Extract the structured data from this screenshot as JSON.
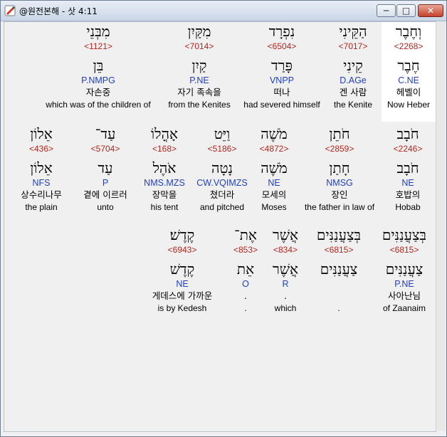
{
  "window": {
    "title": "@원전본해 - 삿 4:11",
    "minimize_label": "─",
    "maximize_label": "□",
    "close_label": "✕"
  },
  "colors": {
    "strong": "#b3261e",
    "morph": "#1f3fc0"
  },
  "rows": [
    {
      "words": [
        {
          "hebrew": "וְחֶבֶר",
          "strong": "<2268>",
          "lemma": "חֶבֶר",
          "morph": "C.NE",
          "korean": "헤벨이",
          "english": "Now Heber",
          "highlighted": true
        },
        {
          "hebrew": "הַקֵּינִי",
          "strong": "<7017>",
          "lemma": "קֵינִי",
          "morph": "D.AGe",
          "korean": "겐 사람",
          "english": "the Kenite",
          "highlighted": false
        },
        {
          "hebrew": "נִפְרָד",
          "strong": "<6504>",
          "lemma": "פָּרַד",
          "morph": "VNPP",
          "korean": "떠나",
          "english": "had severed himself",
          "highlighted": false
        },
        {
          "hebrew": "מִקַּיִן",
          "strong": "<7014>",
          "lemma": "קַיִן",
          "morph": "P.NE",
          "korean": "자기 족속을",
          "english": "from the Kenites",
          "highlighted": false
        },
        {
          "hebrew": "מִבְּנֵי",
          "strong": "<1121>",
          "lemma": "בֵּן",
          "morph": "P.NMPG",
          "korean": "자손중",
          "english": "which was of the children of",
          "highlighted": false
        }
      ]
    },
    {
      "words": [
        {
          "hebrew": "חֹבָב",
          "strong": "<2246>",
          "lemma": "חֹבָב",
          "morph": "NE",
          "korean": "호밥의",
          "english": "Hobab",
          "highlighted": false
        },
        {
          "hebrew": "חֹתֵן",
          "strong": "<2859>",
          "lemma": "חָתַן",
          "morph": "NMSG",
          "korean": "장인",
          "english": "the father in law of",
          "highlighted": false
        },
        {
          "hebrew": "מֹשֶׁה",
          "strong": "<4872>",
          "lemma": "מֹשֶׁה",
          "morph": "NE",
          "korean": "모세의",
          "english": "Moses",
          "highlighted": false
        },
        {
          "hebrew": "וַיֵּט",
          "strong": "<5186>",
          "lemma": "נָטָה",
          "morph": "CW.VQIMZS",
          "korean": "쳤더라",
          "english": "and pitched",
          "highlighted": false
        },
        {
          "hebrew": "אָהֳלוֹ",
          "strong": "<168>",
          "lemma": "אֹהֶל",
          "morph": "NMS.MZS",
          "korean": "장막을",
          "english": "his tent",
          "highlighted": false
        },
        {
          "hebrew": "עַד־",
          "strong": "<5704>",
          "lemma": "עַד",
          "morph": "P",
          "korean": "곁에 이르러",
          "english": "unto",
          "highlighted": false
        },
        {
          "hebrew": "אֵלוֹן",
          "strong": "<436>",
          "lemma": "אֵלוֹן",
          "morph": "NFS",
          "korean": "상수리나무",
          "english": "the plain",
          "highlighted": false
        }
      ]
    },
    {
      "words": [
        {
          "hebrew": "בְּצַעֲנַנִּים",
          "strong": "<6815>",
          "lemma": "צַעֲנַנִּים",
          "morph": "P.NE",
          "korean": "사아난님",
          "english": "of Zaanaim",
          "highlighted": false
        },
        {
          "hebrew": "בְּצַעֲנַנִּים",
          "strong": "<6815>",
          "lemma": "צַעֲנַנִּים",
          "morph": "",
          "korean": "",
          "english": ".",
          "highlighted": false
        },
        {
          "hebrew": "אֲשֶׁר",
          "strong": "<834>",
          "lemma": "אֲשֶׁר",
          "morph": "R",
          "korean": ".",
          "english": "which",
          "highlighted": false
        },
        {
          "hebrew": "אֶת־",
          "strong": "<853>",
          "lemma": "אֵת",
          "morph": "O",
          "korean": ".",
          "english": ".",
          "highlighted": false
        },
        {
          "hebrew": "קֶדֶשׁ׃",
          "strong": "<6943>",
          "lemma": "קֶדֶשׁ",
          "morph": "NE",
          "korean": "게데스에 가까운",
          "english": "is by Kedesh",
          "highlighted": false
        }
      ]
    }
  ]
}
